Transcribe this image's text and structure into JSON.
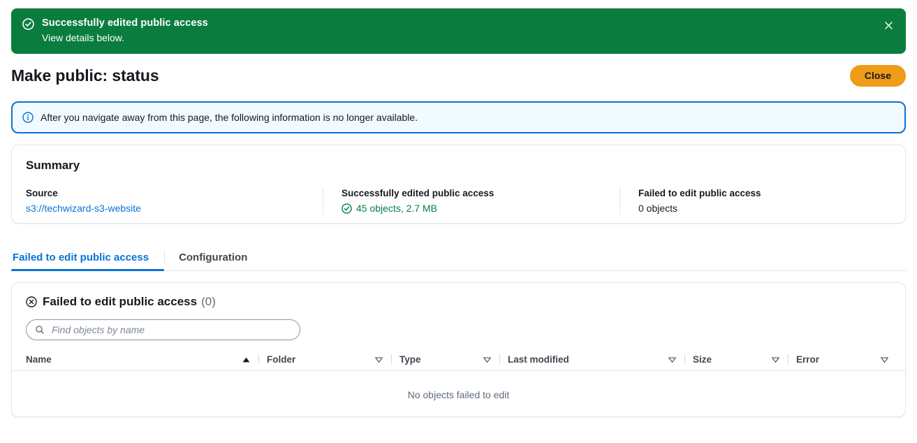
{
  "flash": {
    "title": "Successfully edited public access",
    "subtitle": "View details below.",
    "icon": "check-circle-icon",
    "close_icon": "close-icon",
    "background_color": "#0a7d3e",
    "text_color": "#ffffff"
  },
  "header": {
    "title": "Make public: status",
    "close_label": "Close",
    "close_button_color": "#ef9c18"
  },
  "info_alert": {
    "icon": "info-circle-icon",
    "text": "After you navigate away from this page, the following information is no longer available.",
    "background_color": "#f1faff",
    "border_color": "#0972d3"
  },
  "summary": {
    "heading": "Summary",
    "columns": [
      {
        "label": "Source",
        "value": "s3://techwizard-s3-website",
        "is_link": true,
        "link_color": "#0972d3"
      },
      {
        "label": "Successfully edited public access",
        "value": "45 objects, 2.7 MB",
        "icon": "check-circle-icon",
        "status_color": "#037f45"
      },
      {
        "label": "Failed to edit public access",
        "value": "0 objects"
      }
    ]
  },
  "tabs": [
    {
      "label": "Failed to edit public access",
      "active": true
    },
    {
      "label": "Configuration",
      "active": false
    }
  ],
  "table_panel": {
    "icon": "error-circle-icon",
    "title": "Failed to edit public access",
    "count": "(0)",
    "search": {
      "icon": "search-icon",
      "placeholder": "Find objects by name",
      "value": ""
    },
    "columns": [
      {
        "label": "Name",
        "sort_icon": "sort-ascending-icon",
        "sorted": true
      },
      {
        "label": "Folder",
        "sort_icon": "sort-descending-icon",
        "sorted": false
      },
      {
        "label": "Type",
        "sort_icon": "sort-descending-icon",
        "sorted": false
      },
      {
        "label": "Last modified",
        "sort_icon": "sort-descending-icon",
        "sorted": false
      },
      {
        "label": "Size",
        "sort_icon": "sort-descending-icon",
        "sorted": false
      },
      {
        "label": "Error",
        "sort_icon": "sort-descending-icon",
        "sorted": false
      }
    ],
    "rows": [],
    "empty_message": "No objects failed to edit"
  }
}
